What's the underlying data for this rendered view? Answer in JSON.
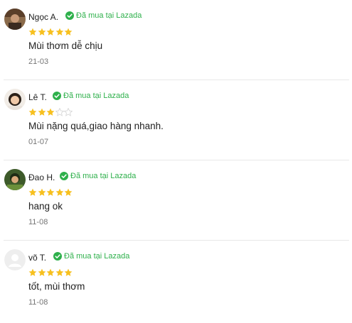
{
  "colors": {
    "star_filled": "#f7c01f",
    "star_empty": "#d7d7d7",
    "verified": "#2eb04b",
    "date": "#757575"
  },
  "reviews": [
    {
      "name": "Ngọc A.",
      "verified_label": "Đã mua tại Lazada",
      "rating": 5,
      "max_rating": 5,
      "content": "Mùi thơm dễ chịu",
      "date": "21-03",
      "avatar": "photo-avatar"
    },
    {
      "name": "Lê T.",
      "verified_label": "Đã mua tại Lazada",
      "rating": 3,
      "max_rating": 5,
      "content": "Mùi nặng quá,giao hàng nhanh.",
      "date": "01-07",
      "avatar": "photo-avatar"
    },
    {
      "name": "Đao H.",
      "verified_label": "Đã mua tại Lazada",
      "rating": 5,
      "max_rating": 5,
      "content": "hang ok",
      "date": "11-08",
      "avatar": "photo-avatar"
    },
    {
      "name": "võ T.",
      "verified_label": "Đã mua tại Lazada",
      "rating": 5,
      "max_rating": 5,
      "content": "tốt,  mùi thơm",
      "date": "11-08",
      "avatar": "default-user-icon"
    }
  ]
}
